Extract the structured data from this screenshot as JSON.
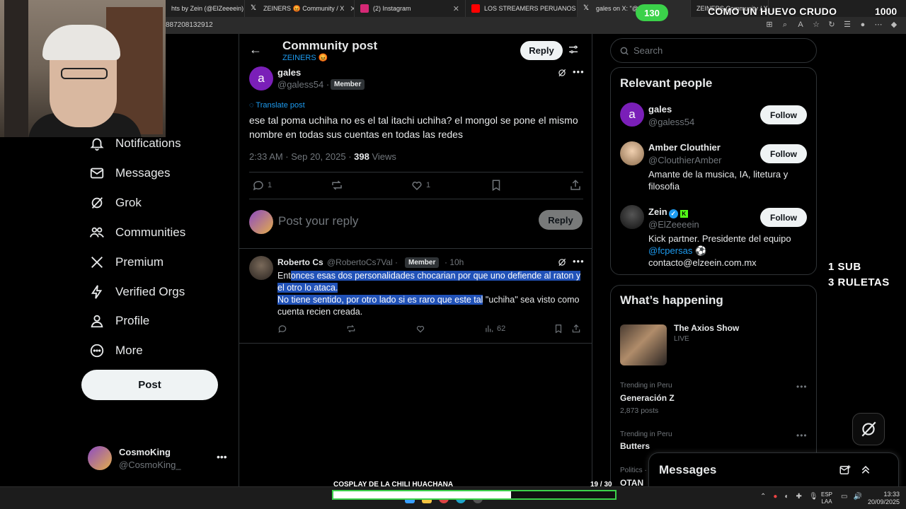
{
  "browser": {
    "tabs": [
      {
        "label": "hts by Zein (@ElZeeeein) /",
        "icon_color": "#1f1f1f"
      },
      {
        "label": "ZEINERS 😡 Community / X",
        "icon_color": "#ffffff"
      },
      {
        "label": "(2) Instagram",
        "icon_color": "#d62976"
      },
      {
        "label": "LOS STREAMERS PERUANOS QU",
        "icon_color": "#ff0000"
      },
      {
        "label": "gales on X: \"@C",
        "icon_color": "#ffffff"
      },
      {
        "label": "ZEINERS Community / X",
        "icon_color": "#ffffff"
      }
    ],
    "url_fragment": "887208132912"
  },
  "overlay": {
    "counter": "130",
    "egg_title": "COMO UN HUEVO CRUDO",
    "egg_count": "1000",
    "sub_line1": "1 SUB",
    "sub_line2": "3 RULETAS",
    "cosplay_title": "COSPLAY DE LA CHILI HUACHANA",
    "cosplay_count": "19  / 30",
    "cosplay_progress": 0.63
  },
  "nav": {
    "items": [
      {
        "label": "Notifications",
        "icon": "bell-icon"
      },
      {
        "label": "Messages",
        "icon": "envelope-icon"
      },
      {
        "label": "Grok",
        "icon": "grok-icon"
      },
      {
        "label": "Communities",
        "icon": "communities-icon"
      },
      {
        "label": "Premium",
        "icon": "x-logo-icon"
      },
      {
        "label": "Verified Orgs",
        "icon": "lightning-icon"
      },
      {
        "label": "Profile",
        "icon": "person-icon"
      },
      {
        "label": "More",
        "icon": "more-circle-icon"
      }
    ],
    "post_label": "Post",
    "account": {
      "name": "CosmoKing",
      "handle": "@CosmoKing_"
    }
  },
  "header": {
    "title": "Community post",
    "subtitle": "ZEINERS 😡",
    "reply_label": "Reply"
  },
  "post": {
    "avatar_letter": "a",
    "name": "gales",
    "handle": "@galess54 ·",
    "member_label": "Member",
    "translate": "Translate post",
    "text": "ese tal poma uchiha no es el tal itachi uchiha? el mongol se pone el mismo nombre en todas sus cuentas en todas las redes",
    "meta_time": "2:33 AM · Sep 20, 2025 · ",
    "meta_views_num": "398",
    "meta_views_label": " Views",
    "replies": "1",
    "likes": "1"
  },
  "compose": {
    "placeholder": "Post your reply",
    "button": "Reply"
  },
  "reply": {
    "name": "Roberto Cs",
    "handle": "@RobertoCs7Val ·",
    "member_label": "Member",
    "time": "· 10h",
    "text_pre": "Ent",
    "text_sel1": "onces esas dos personalidades chocarian por que uno defiende al raton y el otro lo ataca.",
    "text_sel2": "No tiene sentido, por otro lado si es raro que este tal",
    "text_post": " \"uchiha\" sea visto como cuenta recien creada.",
    "views": "62"
  },
  "search": {
    "placeholder": "Search"
  },
  "relevant": {
    "title": "Relevant people",
    "people": [
      {
        "name": "gales",
        "handle": "@galess54",
        "bio": "",
        "follow": "Follow",
        "avatar_letter": "a"
      },
      {
        "name": "Amber Clouthier",
        "handle": "@ClouthierAmber",
        "bio": "Amante de la musica, IA, litetura y filosofia",
        "follow": "Follow"
      },
      {
        "name": "Zein",
        "handle": "@ElZeeeein",
        "bio_line1": "Kick partner. Presidente del equipo",
        "bio_link": "@fcpersas",
        "bio_emoji": " ⚽",
        "bio_line3": "contacto@elzeein.com.mx",
        "follow": "Follow",
        "kick_mark": "K",
        "verified_mark": "✓"
      }
    ]
  },
  "happening": {
    "title": "What’s happening",
    "show_title": "The Axios Show",
    "show_status": "LIVE",
    "trends": [
      {
        "context": "Trending in Peru",
        "name": "Generación Z",
        "count": "2,873 posts"
      },
      {
        "context": "Trending in Peru",
        "name": "Butters",
        "count": ""
      },
      {
        "context": "Politics ·",
        "name": "OTAN",
        "count": ""
      }
    ]
  },
  "messages_drawer": {
    "title": "Messages"
  },
  "taskbar": {
    "lang1": "ESP",
    "lang2": "LAA",
    "time": "13:33",
    "date": "20/09/2025"
  }
}
